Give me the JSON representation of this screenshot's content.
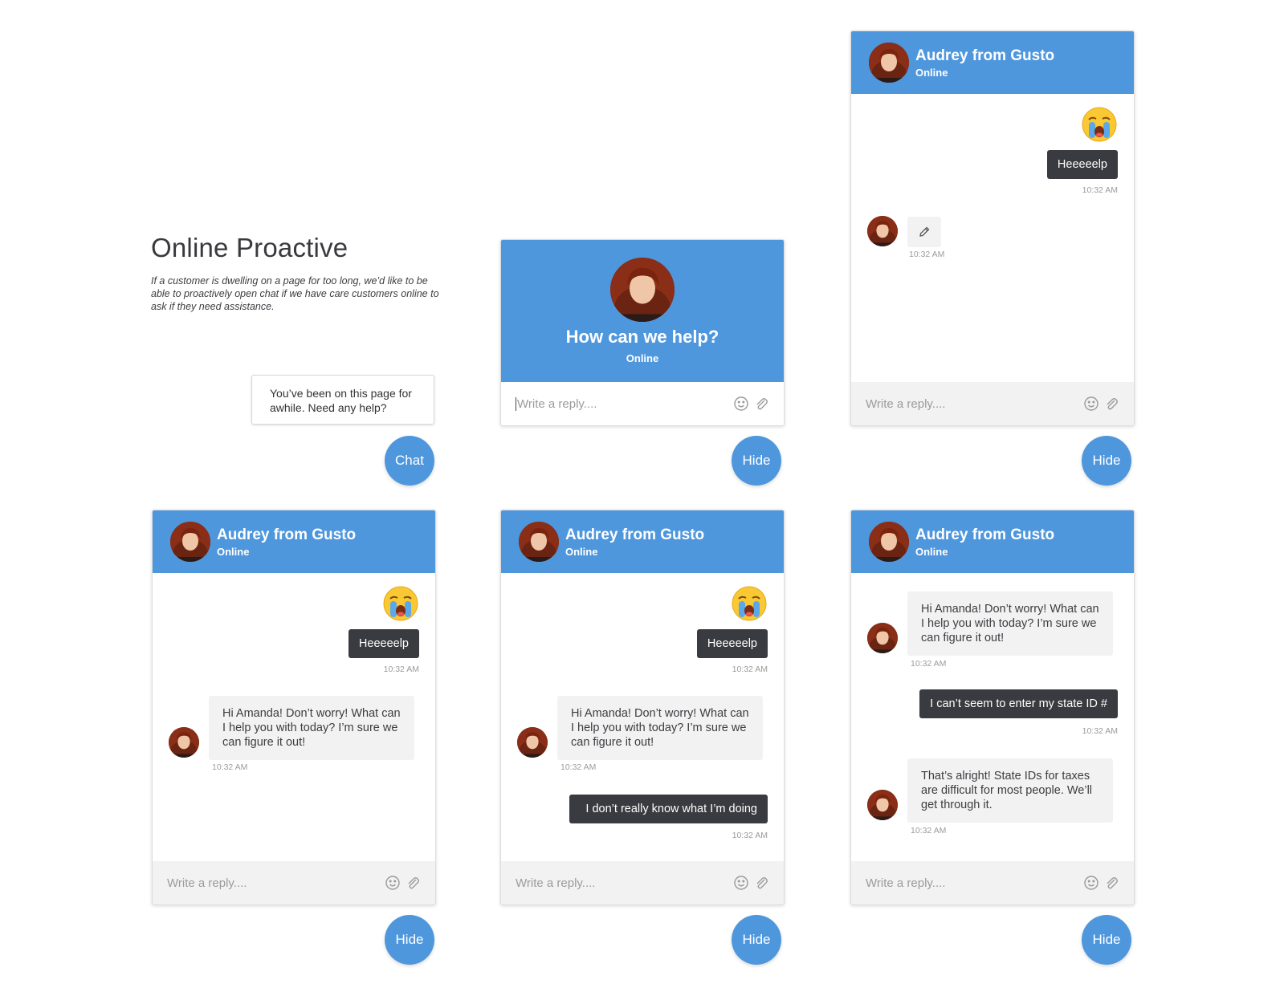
{
  "intro": {
    "title": "Online Proactive",
    "description": "If a customer is dwelling on a page for too long,  we’d like to be able to proactively open chat if we have care customers online to ask if they need assistance."
  },
  "prompt": {
    "text": "You’ve been on this page for awhile. Need any help?",
    "chat_button": "Chat"
  },
  "welcome": {
    "title": "How can we help?",
    "status": "Online",
    "reply_placeholder": "Write a reply....",
    "hide_button": "Hide"
  },
  "agent": {
    "name": "Audrey from Gusto",
    "status": "Online"
  },
  "common": {
    "reply_placeholder": "Write a reply....",
    "hide_label": "Hide",
    "time": "10:32 AM",
    "emoji": "😭",
    "emoji_icon": "crying-face-emoji",
    "composer_icons": [
      "smiley-icon",
      "paperclip-icon"
    ]
  },
  "messages": {
    "help": "Heeeeelp",
    "agent_reply": "Hi Amanda! Don’t worry! What can I help you with today? I’m sure we can figure it out!",
    "user_unsure": "I don’t really know what I’m doing",
    "user_state_id": "I can’t seem to enter my state ID #",
    "agent_followup": "That’s alright! State IDs for taxes are difficult for most people. We’ll get through it."
  },
  "colors": {
    "accent": "#4f97dd",
    "dark_bubble": "#3a3b40",
    "light_bubble": "#f2f2f2",
    "footer": "#f2f2f2"
  }
}
